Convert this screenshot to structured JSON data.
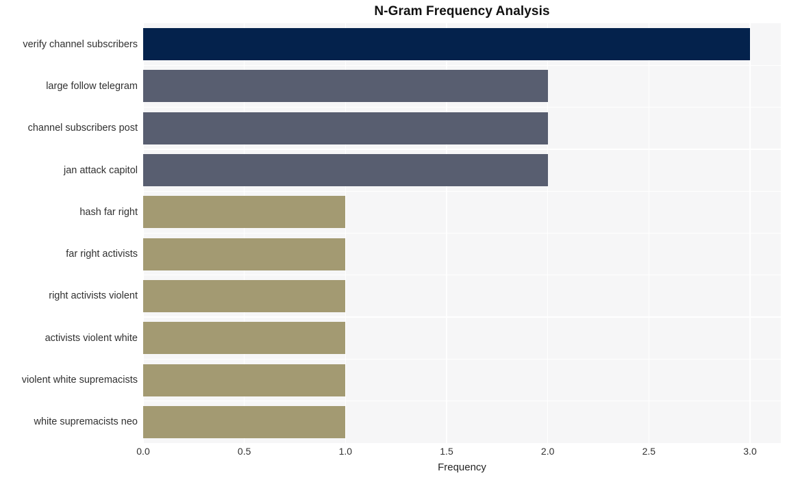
{
  "chart_data": {
    "type": "bar",
    "orientation": "horizontal",
    "title": "N-Gram Frequency Analysis",
    "xlabel": "Frequency",
    "ylabel": "",
    "categories": [
      "verify channel subscribers",
      "large follow telegram",
      "channel subscribers post",
      "jan attack capitol",
      "hash far right",
      "far right activists",
      "right activists violent",
      "activists violent white",
      "violent white supremacists",
      "white supremacists neo"
    ],
    "values": [
      3,
      2,
      2,
      2,
      1,
      1,
      1,
      1,
      1,
      1
    ],
    "bar_colors": [
      "#04224C",
      "#585E70",
      "#585E70",
      "#585E70",
      "#A39A72",
      "#A39A72",
      "#A39A72",
      "#A39A72",
      "#A39A72",
      "#A39A72"
    ],
    "xlim": [
      0.0,
      3.0
    ],
    "xticks": [
      0.0,
      0.5,
      1.0,
      1.5,
      2.0,
      2.5,
      3.0
    ],
    "xtick_labels": [
      "0.0",
      "0.5",
      "1.0",
      "1.5",
      "2.0",
      "2.5",
      "3.0"
    ],
    "grid": true,
    "grid_color": "#FFFFFF",
    "plot_background": "#F6F6F7",
    "figure_background": "#FFFFFF",
    "legend": null
  }
}
